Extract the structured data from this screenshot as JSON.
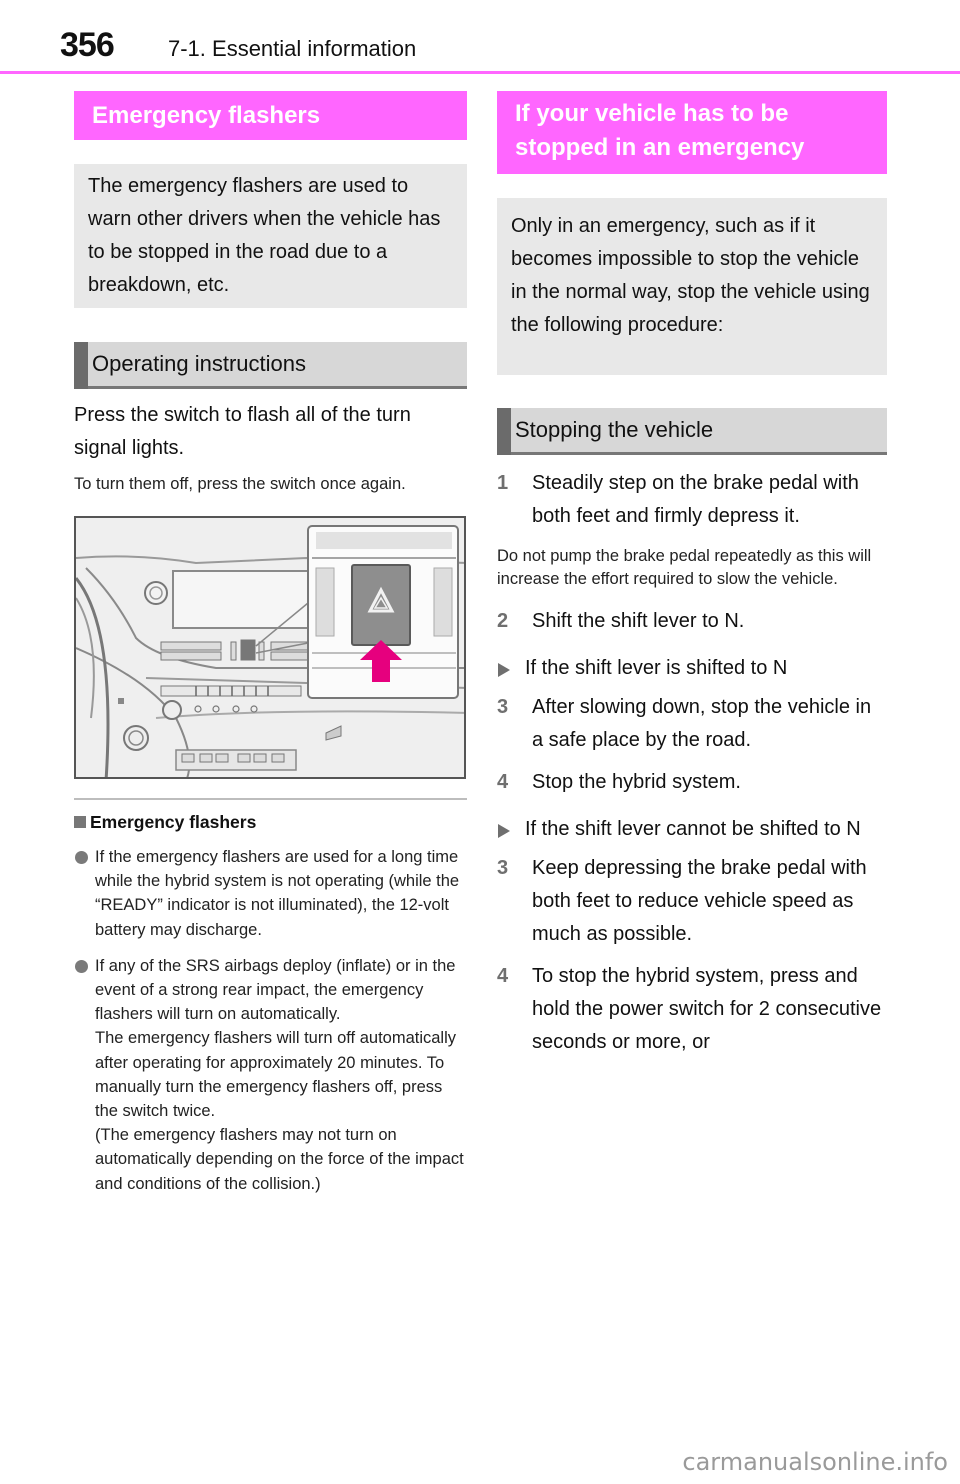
{
  "header": {
    "page_number": "356",
    "chapter": "7-1. Essential information",
    "accent_color": "#ff66ff"
  },
  "left": {
    "section_title": "Emergency flashers",
    "intro": "The emergency flashers are used to warn other drivers when the vehicle has to be stopped in the road due to a breakdown, etc.",
    "subsection_title": "Operating instructions",
    "instruction": "Press the switch to flash all of the turn signal lights.",
    "instruction_note": "To turn them off, press the switch once again.",
    "figure": {
      "description": "Dashboard illustration with callout showing the emergency flasher switch",
      "icon": "hazard-triangle-icon",
      "arrow_color": "#e6007e"
    },
    "notes_title": "Emergency flashers",
    "notes": [
      {
        "paragraphs": [
          "If the emergency flashers are used for a long time while the hybrid system is not operating (while the “READY” indicator is not illuminated), the 12-volt battery may discharge."
        ]
      },
      {
        "paragraphs": [
          "If any of the SRS airbags deploy (inflate) or in the event of a strong rear impact, the emergency flashers will turn on automatically.",
          "The emergency flashers will turn off automatically after operating for approximately 20 minutes. To manually turn the emergency flashers off, press the switch twice.",
          "(The emergency flashers may not turn on automatically depending on the force of the impact and conditions of the collision.)"
        ]
      }
    ]
  },
  "right": {
    "section_title": "If your vehicle has to be stopped in an emergency",
    "intro": "Only in an emergency, such as if it becomes impossible to stop the vehicle in the normal way, stop the vehicle using the following procedure:",
    "subsection_title": "Stopping the vehicle",
    "step1": {
      "num": "1",
      "text": "Steadily step on the brake pedal with both feet and firmly depress it."
    },
    "step1_note": "Do not pump the brake pedal repeatedly as this will increase the effort required to slow the vehicle.",
    "step2": {
      "num": "2",
      "text": "Shift the shift lever to N."
    },
    "case_a": {
      "title": "If the shift lever is shifted to N",
      "steps": [
        {
          "num": "3",
          "text": "After slowing down, stop the vehicle in a safe place by the road."
        },
        {
          "num": "4",
          "text": "Stop the hybrid system."
        }
      ]
    },
    "case_b": {
      "title": "If the shift lever cannot be shifted to N",
      "steps": [
        {
          "num": "3",
          "text": "Keep depressing the brake pedal with both feet to reduce vehicle speed as much as possible."
        },
        {
          "num": "4",
          "text": "To stop the hybrid system, press and hold the power switch for 2 consecutive seconds or more, or"
        }
      ]
    }
  },
  "watermark": "carmanualsonline.info"
}
